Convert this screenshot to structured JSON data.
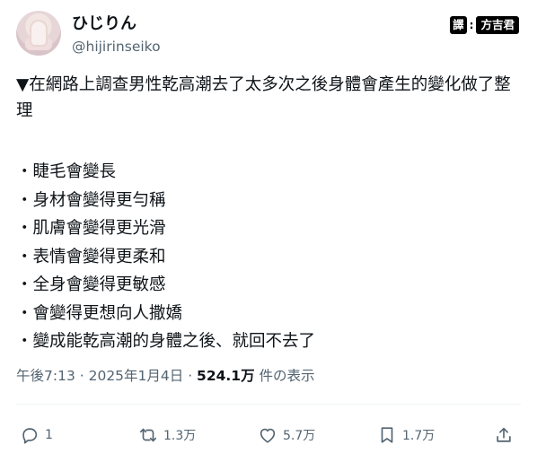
{
  "author": {
    "display_name": "ひじりん",
    "handle": "@hijirinseiko"
  },
  "translator": {
    "mark": "譯",
    "colon": ":",
    "name": "方吉君"
  },
  "post": {
    "title": "▼在網路上調查男性乾高潮去了太多次之後身體會產生的變化做了整理",
    "items": [
      "・睫毛會變長",
      "・身材會變得更勻稱",
      "・肌膚會變得更光滑",
      "・表情會變得更柔和",
      "・全身會變得更敏感",
      "・會變得更想向人撒嬌",
      "・變成能乾高潮的身體之後、就回不去了"
    ]
  },
  "meta": {
    "time": "午後7:13",
    "sep1": " · ",
    "date": "2025年1月4日",
    "sep2": " · ",
    "views_count": "524.1万",
    "views_label": " 件の表示"
  },
  "actions": {
    "reply_count": "1",
    "retweet_count": "1.3万",
    "like_count": "5.7万",
    "bookmark_count": "1.7万"
  },
  "icons": [
    "reply-icon",
    "retweet-icon",
    "like-icon",
    "bookmark-icon",
    "share-icon"
  ]
}
